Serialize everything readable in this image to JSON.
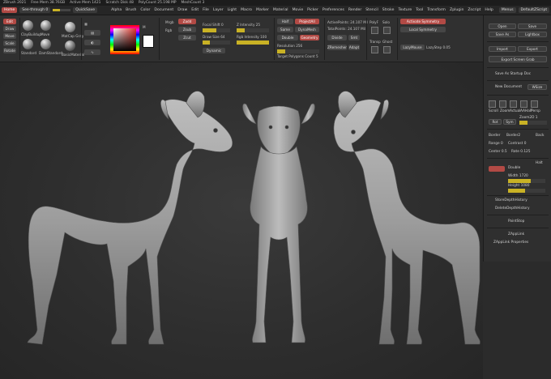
{
  "titlebar": {
    "items": [
      "ZBrush 2021",
      "Free Mem 38.76GB",
      "Active Mem 1421",
      "Scratch Disk 48",
      "PolyCount 25.198 MP",
      "MeshCount 3"
    ]
  },
  "menubar": {
    "app_button": "Home",
    "see_through": "See-through 0",
    "quicksave": "QuickSave",
    "menus": [
      "Alpha",
      "Brush",
      "Color",
      "Document",
      "Draw",
      "Edit",
      "File",
      "Layer",
      "Light",
      "Macro",
      "Marker",
      "Material",
      "Movie",
      "Picker",
      "Preferences",
      "Render",
      "Stencil",
      "Stroke",
      "Texture",
      "Tool",
      "Transform",
      "Zplugin",
      "Zscript",
      "Help"
    ],
    "right_items": [
      "Menus",
      "DefaultZScript"
    ]
  },
  "shelf": {
    "left_buttons": [
      "Edit",
      "Draw",
      "Move",
      "Scale",
      "Rotate"
    ],
    "brush_labels": [
      "ClayBuildup",
      "Standard",
      "Move",
      "DamStandard"
    ],
    "material_labels": [
      "MatCap Gray",
      "BasicMaterial"
    ],
    "rgb_label": "Rgb",
    "mrgb_label": "Mrgb",
    "m_label": "M",
    "zadd": "Zadd",
    "zsub": "Zsub",
    "zcut": "Zcut",
    "focal_shift": "Focal Shift 0",
    "draw_size": "Draw Size 64",
    "z_intensity": "Z Intensity 25",
    "rgb_intensity": "Rgb Intensity 100",
    "dynamic": "Dynamic",
    "sym_labels": [
      "Activate Symmetry",
      "Local Symmetry"
    ],
    "active_points": "ActivePoints: 24.107 Mil",
    "total_points": "TotalPoints: 24.107 Mil",
    "polyframe": "PolyF",
    "solo": "Solo",
    "transp": "Transp",
    "ghost": "Ghost",
    "dynamesh": "DynaMesh",
    "resolution": "Resolution 256",
    "zremesher": "ZRemesher",
    "target_polys": "Target Polygons Count 5",
    "half": "Half",
    "same": "Same",
    "double": "Double",
    "adapt": "Adapt",
    "projectall": "ProjectAll",
    "geometry": "Geometry",
    "divide": "Divide",
    "smt": "Smt",
    "lazy_mouse": "LazyMouse",
    "lazy_step": "LazyStep 0.05"
  },
  "rpanel": {
    "top_buttons": [
      "Open",
      "Save",
      "Save As",
      "Lightbox",
      "Import",
      "Export"
    ],
    "export_label": "Export Screen Grab",
    "save_startup": "Save As Startup Doc",
    "new_document": "New Document",
    "wsize": "WSize",
    "navigation": [
      "Scroll",
      "Zoom",
      "Actual",
      "AAHalf",
      "Persp",
      "Floor",
      "Local"
    ],
    "zoom2d": "Zoom2D 1",
    "rot": "Rot",
    "sym": "Sym",
    "border": "Border",
    "border2": "Border2",
    "range": "Range 0",
    "contrast": "Contrast 0",
    "center": "Center 0.5",
    "rate": "Rate 0.125",
    "back": "Back",
    "halt": "Halt",
    "double_btn": "Double",
    "width": "Width 1720",
    "height": "Height 1080",
    "store_depth": "StoreDepthHistory",
    "delete_depth": "DeleteDepthHistory",
    "paintstop": "PaintStop",
    "zapplink": "ZAppLink",
    "zapplink_props": "ZAppLink Properties"
  },
  "colors": {
    "accent_red": "#b24a45",
    "slider_yellow": "#c9b225",
    "ui_dark": "#2b2b2b"
  },
  "viewport": {
    "model_views": [
      "deer-side-left",
      "deer-front",
      "deer-side-right"
    ]
  }
}
